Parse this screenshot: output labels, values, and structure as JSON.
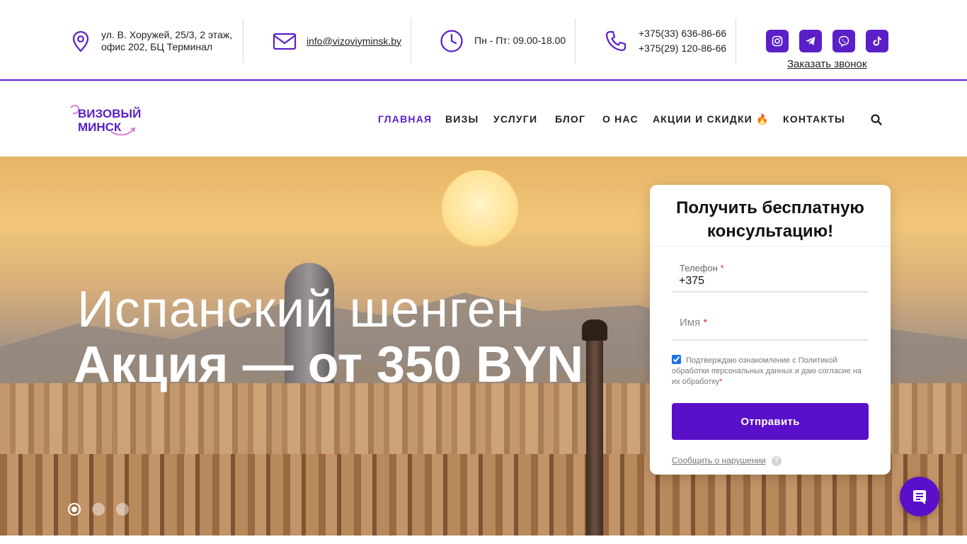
{
  "topbar": {
    "address": "ул. В. Хоружей, 25/3, 2 этаж,\nофис 202, БЦ Терминал",
    "address_line1": "ул. В. Хоружей, 25/3, 2 этаж,",
    "address_line2": "офис 202, БЦ Терминал",
    "email": "info@vizoviyminsk.by",
    "hours": "Пн - Пт: 09.00-18.00",
    "phone1": "+375(33) 636-86-66",
    "phone2": "+375(29) 120-86-66",
    "callback_label": "Заказать звонок",
    "social": [
      "instagram-icon",
      "telegram-icon",
      "viber-icon",
      "tiktok-icon"
    ]
  },
  "nav": {
    "logo_text_line1": "ВИЗОВЫЙ",
    "logo_text_line2": "МИНСК",
    "items": [
      {
        "label": "ГЛАВНАЯ",
        "active": true
      },
      {
        "label": "ВИЗЫ"
      },
      {
        "label": "УСЛУГИ"
      },
      {
        "label": "БЛОГ"
      },
      {
        "label": "О НАС"
      },
      {
        "label": "АКЦИИ И СКИДКИ 🔥"
      },
      {
        "label": "КОНТАКТЫ"
      }
    ]
  },
  "hero": {
    "title": "Испанский шенген",
    "subtitle": "Акция — от 350 BYN",
    "slides_count": 3,
    "active_slide": 1
  },
  "form": {
    "title": "Получить бесплатную консультацию!",
    "phone_label": "Телефон",
    "phone_value": "+375",
    "name_label": "Имя",
    "required_mark": "*",
    "consent_text": "Подтверждаю ознакомление с Политикой обработки персональных данных и даю согласие на их обработку",
    "consent_checked": true,
    "submit_label": "Отправить",
    "report_label": "Сообщить о нарушении",
    "help_glyph": "?"
  },
  "colors": {
    "brand": "#5a1fc8",
    "button": "#5a10c9",
    "required": "#e0333a"
  }
}
